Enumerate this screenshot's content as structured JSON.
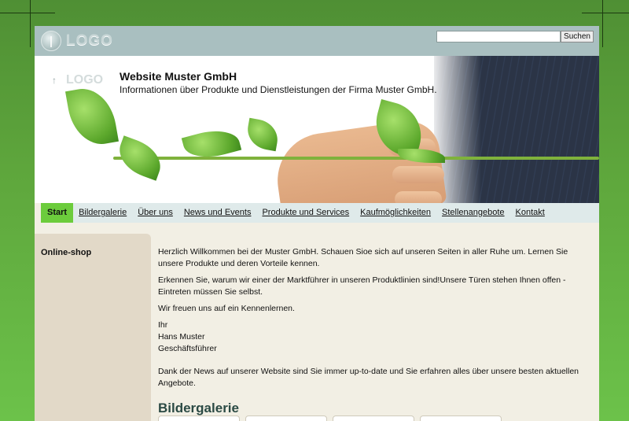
{
  "header": {
    "logo_text": "LOGO",
    "search": {
      "value": "",
      "placeholder": "",
      "button_label": "Suchen"
    }
  },
  "banner": {
    "logo_text": "LOGO",
    "title": "Website Muster GmbH",
    "subtitle": "Informationen über Produkte und Dienstleistungen der Firma Muster GmbH."
  },
  "nav": {
    "items": [
      {
        "label": "Start",
        "active": true
      },
      {
        "label": "Bildergalerie"
      },
      {
        "label": "Über uns"
      },
      {
        "label": "News und Events"
      },
      {
        "label": "Produkte und Services"
      },
      {
        "label": "Kaufmöglichkeiten"
      },
      {
        "label": "Stellenangebote"
      },
      {
        "label": "Kontakt"
      }
    ]
  },
  "sidebar": {
    "title": "Online-shop"
  },
  "content": {
    "p1": "Herzlich Willkommen bei der Muster GmbH. Schauen Sioe sich auf unseren Seiten in aller Ruhe um. Lernen Sie unsere Produkte und deren Vorteile kennen.",
    "p2": "Erkennen Sie, warum wir einer der Marktführer in unseren Produktlinien sind!Unsere Türen stehen Ihnen offen - Eintreten müssen Sie selbst.",
    "p3": "Wir freuen uns auf ein Kennenlernen.",
    "sign1": "Ihr",
    "sign2": "Hans Muster",
    "sign3": "Geschäftsführer",
    "news": "Dank der News auf unserer Website sind Sie immer up-to-date und Sie erfahren alles über unsere besten aktuellen Angebote.",
    "gallery_heading": "Bildergalerie"
  },
  "colors": {
    "background_green": "#5ea63c",
    "topbar": "#a9bfc0",
    "nav_bg": "#dfeaea",
    "nav_active": "#6ccc3c",
    "sidebar": "#e2d9c8",
    "content_bg": "#f2efe4",
    "heading": "#2b4a44"
  }
}
